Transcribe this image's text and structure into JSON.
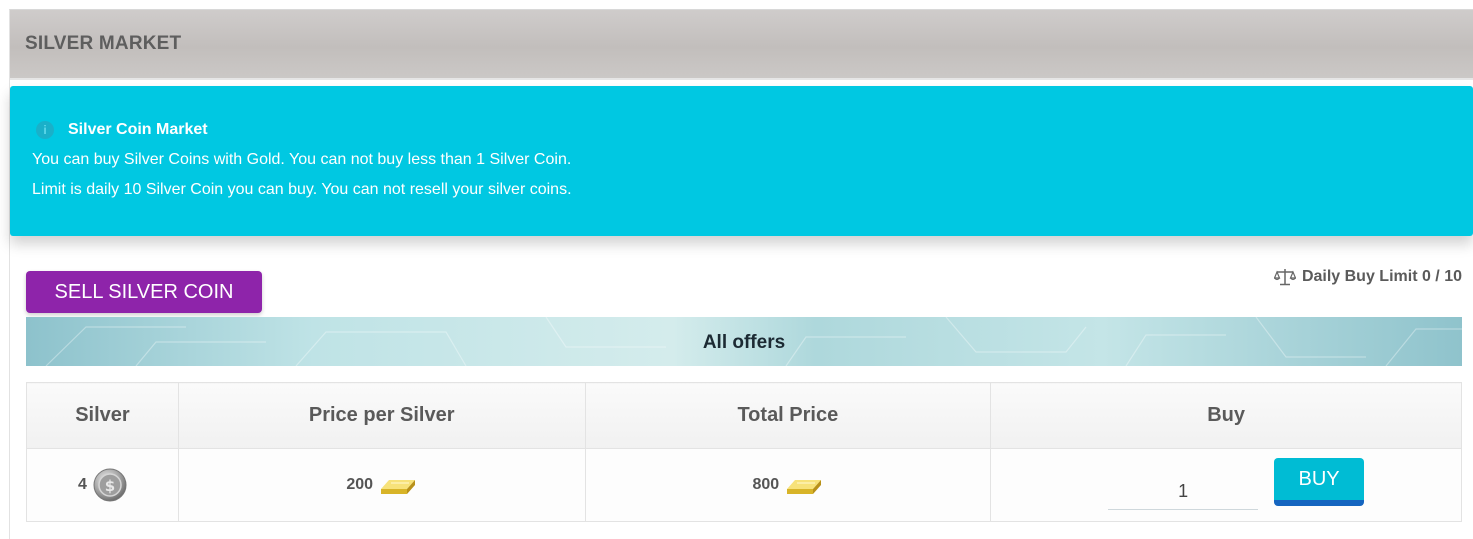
{
  "page": {
    "title": "SILVER MARKET"
  },
  "info": {
    "title": "Silver Coin Market",
    "line1": "You can buy Silver Coins with Gold. You can not buy less than 1 Silver Coin.",
    "line2": "Limit is daily 10 Silver Coin you can buy. You can not resell your silver coins.",
    "icon": "info-icon"
  },
  "actions": {
    "sell_label": "SELL SILVER COIN"
  },
  "limit": {
    "label": "Daily Buy Limit 0 / 10",
    "icon": "scale-icon"
  },
  "offers": {
    "title": "All offers",
    "columns": [
      "Silver",
      "Price per Silver",
      "Total Price",
      "Buy"
    ],
    "rows": [
      {
        "silver": "4",
        "price_per_silver": "200",
        "total_price": "800",
        "quantity": "1",
        "buy_label": "BUY"
      }
    ]
  },
  "colors": {
    "info_bg": "#00c8e2",
    "sell_button": "#8e24aa",
    "buy_button": "#00bcd4",
    "buy_button_border": "#1565c0"
  }
}
